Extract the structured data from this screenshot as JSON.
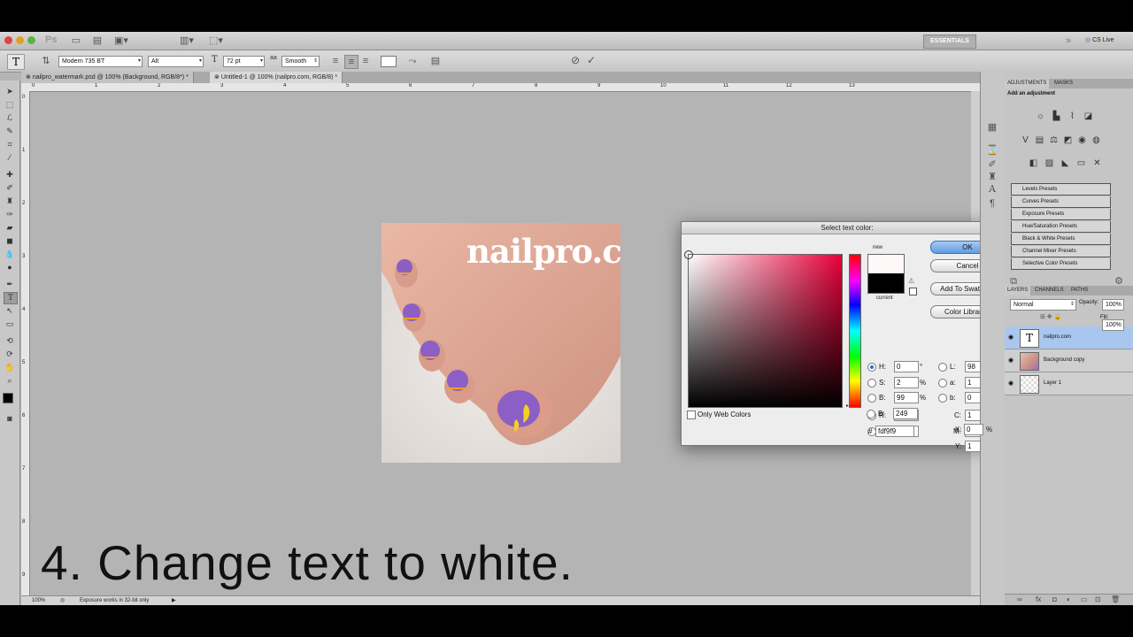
{
  "app": {
    "ps_logo": "Ps",
    "workspace": "ESSENTIALS",
    "cs_live": "CS Live"
  },
  "options": {
    "font_family": "Modern 735 BT",
    "font_style": "Alt",
    "font_size": "72 pt",
    "antialias": "Smooth"
  },
  "tabs": [
    {
      "label": "nailpro_watermark.psd @ 100% (Background, RGB/8*) *"
    },
    {
      "label": "Untitled-1 @ 100% (nailpro.com, RGB/8) *"
    }
  ],
  "ruler": {
    "h": [
      "0",
      "1",
      "2",
      "3",
      "4",
      "5",
      "6",
      "7",
      "8",
      "9",
      "10",
      "11",
      "12",
      "13"
    ],
    "v": [
      "0",
      "1",
      "2",
      "3",
      "4",
      "5",
      "6",
      "7",
      "8",
      "9"
    ]
  },
  "document": {
    "watermark_text": "nailpro.com"
  },
  "caption": "4. Change text to white.",
  "status": {
    "zoom": "100%",
    "message": "Exposure works in 32-bit only"
  },
  "dialog": {
    "title": "Select text color:",
    "new_label": "new",
    "current_label": "current",
    "ok": "OK",
    "cancel": "Cancel",
    "add_swatches": "Add To Swatches",
    "color_libraries": "Color Libraries",
    "only_web": "Only Web Colors",
    "hsb": [
      {
        "label": "H:",
        "value": "0",
        "unit": "°"
      },
      {
        "label": "S:",
        "value": "2",
        "unit": "%"
      },
      {
        "label": "B:",
        "value": "99",
        "unit": "%"
      }
    ],
    "rgb": [
      {
        "label": "R:",
        "value": "253"
      },
      {
        "label": "G:",
        "value": "249"
      },
      {
        "label": "B:",
        "value": "249"
      }
    ],
    "lab": [
      {
        "label": "L:",
        "value": "98"
      },
      {
        "label": "a:",
        "value": "1"
      },
      {
        "label": "b:",
        "value": "0"
      }
    ],
    "cmyk": [
      {
        "label": "C:",
        "value": "1",
        "unit": "%"
      },
      {
        "label": "M:",
        "value": "2",
        "unit": "%"
      },
      {
        "label": "Y:",
        "value": "1",
        "unit": "%"
      },
      {
        "label": "K:",
        "value": "0",
        "unit": "%"
      }
    ],
    "hex_label": "#",
    "hex": "fdf9f9",
    "new_color": "#fdf9f9",
    "current_color": "#000000"
  },
  "adjustments": {
    "tabs": [
      "ADJUSTMENTS",
      "MASKS"
    ],
    "header": "Add an adjustment",
    "presets": [
      "Levels Presets",
      "Curves Presets",
      "Exposure Presets",
      "Hue/Saturation Presets",
      "Black & White Presets",
      "Channel Mixer Presets",
      "Selective Color Presets"
    ]
  },
  "layers": {
    "tabs": [
      "LAYERS",
      "CHANNELS",
      "PATHS"
    ],
    "blend_mode": "Normal",
    "opacity_label": "Opacity:",
    "opacity": "100%",
    "fill_label": "Fill:",
    "fill": "100%",
    "items": [
      {
        "name": "nailpro.com",
        "selected": true
      },
      {
        "name": "Background copy"
      },
      {
        "name": "Layer 1"
      }
    ]
  },
  "colors": {
    "accent": "#5e9be3",
    "selection": "#a9c6ee",
    "panel": "#c5c5c5"
  }
}
